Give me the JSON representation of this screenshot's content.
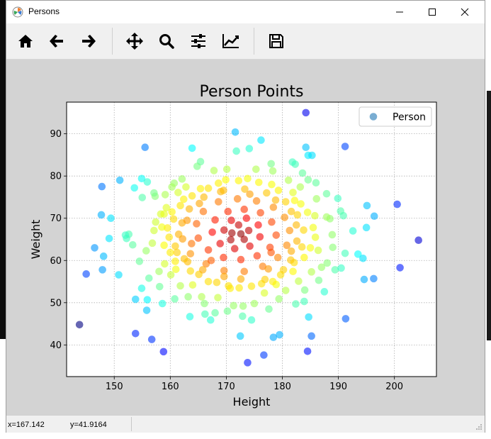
{
  "window": {
    "title": "Persons"
  },
  "toolbar": {
    "buttons": [
      {
        "id": "home",
        "icon": "home-icon"
      },
      {
        "id": "back",
        "icon": "arrow-left-icon"
      },
      {
        "id": "forward",
        "icon": "arrow-right-icon"
      },
      {
        "id": "pan",
        "icon": "move-icon"
      },
      {
        "id": "zoom",
        "icon": "search-icon"
      },
      {
        "id": "subplots",
        "icon": "sliders-icon"
      },
      {
        "id": "edit",
        "icon": "line-chart-icon"
      },
      {
        "id": "save",
        "icon": "save-icon"
      }
    ]
  },
  "status": {
    "x": "x=167.142",
    "y": "y=41.9164"
  },
  "chart_data": {
    "type": "scatter",
    "title": "Person Points",
    "xlabel": "Height",
    "ylabel": "Weight",
    "xlim": [
      141.5,
      207.5
    ],
    "ylim": [
      32.5,
      97.5
    ],
    "xticks": [
      150,
      160,
      170,
      180,
      190,
      200
    ],
    "yticks": [
      40,
      50,
      60,
      70,
      80,
      90
    ],
    "grid": true,
    "legend": {
      "label": "Person",
      "position": "top-right",
      "marker_color": "#1f77b4"
    },
    "colormap": "jet, colored by distance from center",
    "center": [
      172,
      66
    ],
    "series": [
      {
        "name": "Person",
        "points": [
          [
            184.2,
            95.0
          ],
          [
            143.8,
            44.8
          ],
          [
            204.3,
            64.8
          ],
          [
            145.0,
            56.8
          ],
          [
            147.8,
            77.5
          ],
          [
            153.8,
            42.7
          ],
          [
            155.5,
            86.8
          ],
          [
            156.7,
            41.3
          ],
          [
            158.8,
            38.4
          ],
          [
            173.8,
            35.8
          ],
          [
            176.7,
            37.6
          ],
          [
            184.5,
            38.5
          ],
          [
            191.2,
            87.0
          ],
          [
            200.5,
            73.3
          ],
          [
            201.0,
            58.3
          ],
          [
            147.7,
            70.8
          ],
          [
            146.5,
            63.0
          ],
          [
            147.9,
            57.8
          ],
          [
            148.1,
            61.0
          ],
          [
            149.4,
            70.0
          ],
          [
            149.1,
            65.2
          ],
          [
            150.8,
            56.6
          ],
          [
            151.0,
            79.0
          ],
          [
            153.6,
            77.2
          ],
          [
            153.8,
            50.8
          ],
          [
            155.8,
            48.2
          ],
          [
            157.3,
            75.2
          ],
          [
            163.9,
            86.6
          ],
          [
            171.6,
            90.4
          ],
          [
            176.2,
            88.5
          ],
          [
            184.6,
            84.9
          ],
          [
            185.3,
            84.9
          ],
          [
            184.2,
            86.8
          ],
          [
            191.3,
            46.2
          ],
          [
            195.1,
            73.0
          ],
          [
            196.4,
            70.5
          ],
          [
            196.3,
            55.7
          ],
          [
            194.6,
            55.5
          ],
          [
            195.0,
            67.8
          ],
          [
            194.4,
            60.5
          ],
          [
            185.2,
            42.1
          ],
          [
            178.4,
            41.8
          ],
          [
            179.5,
            42.4
          ],
          [
            172.5,
            42.1
          ],
          [
            154.9,
            79.4
          ],
          [
            155.9,
            78.6
          ],
          [
            157.1,
            76.0
          ],
          [
            155.0,
            74.9
          ],
          [
            154.5,
            59.8
          ],
          [
            154.9,
            53.4
          ],
          [
            155.9,
            50.7
          ],
          [
            156.2,
            55.8
          ],
          [
            158.6,
            49.8
          ],
          [
            158.1,
            53.8
          ],
          [
            160.8,
            50.9
          ],
          [
            163.5,
            46.7
          ],
          [
            166.2,
            47.3
          ],
          [
            167.2,
            45.9
          ],
          [
            170.2,
            48.0
          ],
          [
            172.9,
            46.8
          ],
          [
            174.5,
            45.9
          ],
          [
            177.6,
            48.5
          ],
          [
            182.4,
            49.7
          ],
          [
            183.9,
            50.3
          ],
          [
            184.7,
            46.6
          ],
          [
            186.5,
            55.3
          ],
          [
            187.5,
            52.6
          ],
          [
            189.4,
            57.8
          ],
          [
            190.5,
            58.2
          ],
          [
            191.2,
            61.7
          ],
          [
            192.6,
            67.0
          ],
          [
            193.5,
            61.5
          ],
          [
            190.9,
            70.6
          ],
          [
            190.4,
            71.7
          ],
          [
            189.9,
            74.7
          ],
          [
            187.9,
            75.8
          ],
          [
            186.0,
            78.4
          ],
          [
            183.2,
            77.4
          ],
          [
            182.3,
            82.8
          ],
          [
            183.6,
            80.7
          ],
          [
            181.8,
            83.3
          ],
          [
            178.0,
            82.9
          ],
          [
            174.1,
            86.5
          ],
          [
            171.8,
            85.9
          ],
          [
            170.1,
            81.6
          ],
          [
            165.4,
            83.4
          ],
          [
            162.1,
            79.3
          ],
          [
            160.7,
            78.3
          ],
          [
            159.1,
            75.6
          ],
          [
            158.3,
            71.0
          ],
          [
            157.4,
            69.1
          ],
          [
            152.6,
            66.2
          ],
          [
            152.2,
            65.2
          ],
          [
            153.3,
            63.7
          ],
          [
            152.0,
            66.0
          ],
          [
            158.0,
            57.4
          ],
          [
            159.0,
            59.2
          ],
          [
            160.1,
            56.6
          ],
          [
            161.8,
            54.0
          ],
          [
            163.2,
            51.4
          ],
          [
            166.1,
            49.8
          ],
          [
            168.0,
            47.6
          ],
          [
            171.3,
            49.3
          ],
          [
            173.0,
            49.2
          ],
          [
            175.0,
            49.8
          ],
          [
            179.4,
            50.9
          ],
          [
            180.6,
            52.9
          ],
          [
            184.0,
            53.0
          ],
          [
            187.0,
            58.4
          ],
          [
            188.0,
            59.4
          ],
          [
            189.0,
            63.1
          ],
          [
            188.9,
            66.1
          ],
          [
            188.5,
            69.9
          ],
          [
            187.9,
            70.3
          ],
          [
            186.1,
            74.6
          ],
          [
            184.6,
            79.1
          ],
          [
            181.1,
            79.0
          ],
          [
            178.3,
            81.2
          ],
          [
            175.3,
            81.6
          ],
          [
            167.8,
            81.3
          ],
          [
            164.8,
            82.3
          ],
          [
            162.8,
            77.4
          ],
          [
            160.3,
            77.4
          ],
          [
            158.9,
            71.0
          ],
          [
            157.1,
            67.1
          ],
          [
            155.7,
            62.3
          ],
          [
            156.8,
            64.1
          ],
          [
            160.0,
            61.9
          ],
          [
            161.0,
            57.9
          ],
          [
            164.0,
            54.2
          ],
          [
            165.6,
            51.4
          ],
          [
            168.5,
            51.2
          ],
          [
            170.7,
            53.4
          ],
          [
            176.8,
            52.3
          ],
          [
            178.9,
            54.3
          ],
          [
            182.9,
            55.1
          ],
          [
            185.2,
            57.3
          ],
          [
            186.4,
            62.4
          ],
          [
            185.9,
            65.5
          ],
          [
            185.8,
            70.6
          ],
          [
            183.3,
            73.4
          ],
          [
            181.9,
            76.1
          ],
          [
            178.1,
            78.0
          ],
          [
            173.8,
            79.4
          ],
          [
            169.9,
            79.1
          ],
          [
            166.8,
            77.1
          ],
          [
            163.9,
            75.3
          ],
          [
            161.8,
            73.0
          ],
          [
            160.6,
            69.8
          ],
          [
            159.8,
            65.5
          ],
          [
            161.2,
            61.9
          ],
          [
            163.1,
            59.7
          ],
          [
            165.1,
            56.7
          ],
          [
            168.3,
            54.8
          ],
          [
            172.3,
            53.5
          ],
          [
            176.3,
            54.5
          ],
          [
            179.7,
            56.6
          ],
          [
            182.1,
            59.5
          ],
          [
            183.5,
            63.2
          ],
          [
            183.8,
            67.2
          ],
          [
            182.7,
            70.8
          ],
          [
            180.6,
            73.9
          ],
          [
            177.2,
            76.0
          ],
          [
            173.3,
            76.9
          ],
          [
            169.5,
            76.6
          ],
          [
            166.0,
            75.0
          ],
          [
            163.4,
            72.2
          ],
          [
            162.1,
            68.9
          ],
          [
            162.2,
            65.1
          ],
          [
            163.6,
            61.6
          ],
          [
            166.4,
            59.2
          ],
          [
            169.6,
            57.6
          ],
          [
            173.2,
            57.4
          ],
          [
            176.5,
            58.6
          ],
          [
            179.2,
            60.7
          ],
          [
            180.8,
            63.6
          ],
          [
            181.3,
            67.1
          ],
          [
            180.4,
            70.2
          ],
          [
            178.4,
            72.6
          ],
          [
            175.4,
            74.1
          ],
          [
            172.0,
            74.6
          ],
          [
            168.6,
            73.9
          ],
          [
            165.9,
            71.6
          ],
          [
            164.7,
            68.7
          ],
          [
            165.0,
            65.3
          ],
          [
            166.8,
            62.5
          ],
          [
            169.5,
            60.7
          ],
          [
            172.6,
            60.2
          ],
          [
            175.5,
            61.1
          ],
          [
            177.8,
            63.1
          ],
          [
            178.9,
            66.0
          ],
          [
            178.1,
            69.1
          ],
          [
            176.1,
            71.3
          ],
          [
            173.2,
            72.1
          ],
          [
            170.3,
            71.6
          ],
          [
            168.0,
            69.6
          ],
          [
            167.5,
            66.7
          ],
          [
            168.9,
            64.0
          ],
          [
            171.5,
            62.8
          ],
          [
            174.2,
            63.4
          ],
          [
            176.0,
            65.6
          ],
          [
            175.7,
            68.4
          ],
          [
            173.6,
            70.0
          ],
          [
            170.9,
            69.5
          ],
          [
            169.6,
            67.2
          ],
          [
            170.8,
            64.9
          ],
          [
            173.2,
            65.0
          ],
          [
            174.0,
            67.1
          ],
          [
            172.2,
            68.4
          ],
          [
            171.0,
            66.5
          ],
          [
            172.6,
            66.3
          ],
          [
            177.5,
            58.0
          ],
          [
            180.2,
            57.8
          ],
          [
            181.5,
            60.1
          ],
          [
            167.3,
            60.0
          ],
          [
            163.8,
            64.0
          ],
          [
            161.5,
            66.2
          ],
          [
            163.0,
            69.5
          ],
          [
            165.2,
            73.5
          ],
          [
            169.0,
            76.3
          ],
          [
            174.2,
            75.7
          ],
          [
            178.8,
            74.3
          ],
          [
            181.6,
            71.6
          ],
          [
            182.5,
            68.4
          ],
          [
            182.6,
            64.6
          ],
          [
            181.6,
            62.2
          ],
          [
            178.0,
            61.9
          ],
          [
            176.9,
            55.5
          ],
          [
            172.6,
            55.6
          ],
          [
            169.6,
            56.2
          ],
          [
            165.8,
            57.8
          ],
          [
            162.5,
            60.4
          ],
          [
            160.9,
            63.4
          ],
          [
            159.5,
            67.7
          ],
          [
            160.3,
            71.5
          ],
          [
            162.4,
            74.5
          ],
          [
            165.4,
            77.0
          ],
          [
            168.6,
            78.3
          ],
          [
            172.2,
            78.9
          ],
          [
            175.8,
            78.5
          ],
          [
            179.3,
            76.6
          ],
          [
            182.2,
            74.2
          ],
          [
            184.5,
            71.4
          ],
          [
            185.5,
            67.8
          ],
          [
            185.0,
            63.0
          ],
          [
            183.9,
            60.7
          ],
          [
            181.9,
            57.4
          ],
          [
            178.3,
            55.0
          ],
          [
            174.5,
            53.9
          ],
          [
            170.4,
            54.0
          ],
          [
            166.8,
            55.0
          ],
          [
            163.6,
            57.5
          ],
          [
            160.9,
            59.8
          ],
          [
            158.9,
            63.6
          ],
          [
            158.5,
            67.9
          ],
          [
            159.3,
            72.5
          ],
          [
            161.4,
            76.1
          ]
        ]
      }
    ]
  }
}
